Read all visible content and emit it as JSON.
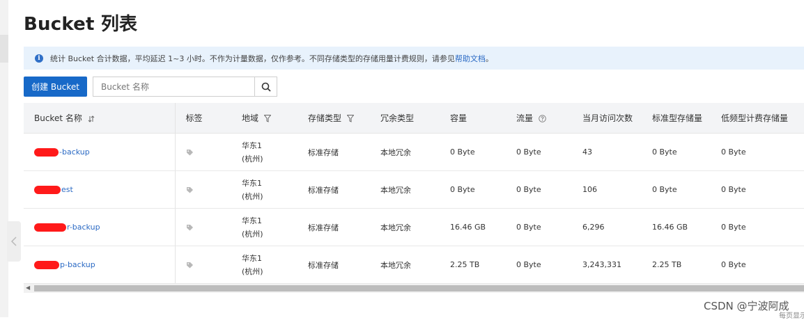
{
  "page": {
    "title": "Bucket 列表"
  },
  "info_bar": {
    "text": "统计 Bucket 合计数据，平均延迟 1~3 小时。不作为计量数据，仅作参考。不同存储类型的存储用量计费规则，请参见",
    "link": "帮助文档",
    "suffix": "。"
  },
  "toolbar": {
    "create_label": "创建 Bucket",
    "search_placeholder": "Bucket 名称"
  },
  "table": {
    "columns": [
      "Bucket 名称",
      "标签",
      "地域",
      "存储类型",
      "冗余类型",
      "容量",
      "流量",
      "当月访问次数",
      "标准型存储量",
      "低频型计费存储量"
    ],
    "rows": [
      {
        "name": "-backup",
        "region_1": "华东1",
        "region_2": "(杭州)",
        "storage_class": "标准存储",
        "redundancy": "本地冗余",
        "capacity": "0 Byte",
        "traffic": "0 Byte",
        "visits": "43",
        "standard_storage": "0 Byte",
        "ia_storage": "0 Byte"
      },
      {
        "name": "est",
        "region_1": "华东1",
        "region_2": "(杭州)",
        "storage_class": "标准存储",
        "redundancy": "本地冗余",
        "capacity": "0 Byte",
        "traffic": "0 Byte",
        "visits": "106",
        "standard_storage": "0 Byte",
        "ia_storage": "0 Byte"
      },
      {
        "name": "r-backup",
        "region_1": "华东1",
        "region_2": "(杭州)",
        "storage_class": "标准存储",
        "redundancy": "本地冗余",
        "capacity": "16.46 GB",
        "traffic": "0 Byte",
        "visits": "6,296",
        "standard_storage": "16.46 GB",
        "ia_storage": "0 Byte"
      },
      {
        "name": "p-backup",
        "region_1": "华东1",
        "region_2": "(杭州)",
        "storage_class": "标准存储",
        "redundancy": "本地冗余",
        "capacity": "2.25 TB",
        "traffic": "0 Byte",
        "visits": "3,243,331",
        "standard_storage": "2.25 TB",
        "ia_storage": "0 Byte"
      }
    ]
  },
  "watermark": "CSDN @宁波阿成",
  "corner_text": "每页显示"
}
